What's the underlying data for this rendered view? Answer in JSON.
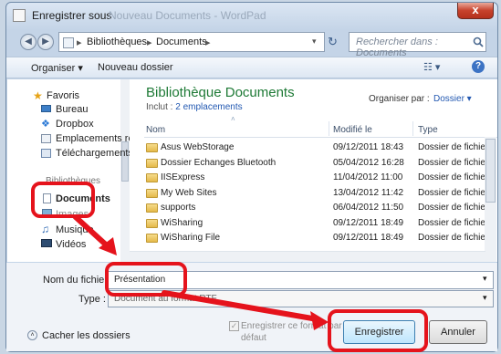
{
  "window": {
    "title": "Enregistrer sous",
    "title_ghost": "Nouveau Documents - WordPad",
    "close_label": "x"
  },
  "address_bar": {
    "crumbs": [
      "Bibliothèques",
      "Documents"
    ],
    "separator": "▸",
    "refresh_glyph": "↻",
    "search_placeholder": "Rechercher dans : Documents"
  },
  "toolbar": {
    "organize_label": "Organiser ▾",
    "new_folder_label": "Nouveau dossier",
    "view_glyph": "☷ ▾",
    "help_glyph": "?"
  },
  "sidebar": {
    "favorites_header": "Favoris",
    "favorites": [
      {
        "label": "Bureau",
        "icon": "desktop-icon"
      },
      {
        "label": "Dropbox",
        "icon": "dropbox-icon"
      },
      {
        "label": "Emplacements ré",
        "icon": "recent-places-icon"
      },
      {
        "label": "Téléchargements",
        "icon": "downloads-icon"
      }
    ],
    "libraries_header": "Bibliothèques",
    "libraries": [
      {
        "label": "Documents",
        "icon": "documents-icon"
      },
      {
        "label": "Images",
        "icon": "pictures-icon"
      },
      {
        "label": "Musique",
        "icon": "music-icon"
      },
      {
        "label": "Vidéos",
        "icon": "videos-icon"
      }
    ]
  },
  "library": {
    "title": "Bibliothèque Documents",
    "includes_prefix": "Inclut :",
    "includes_link": "2 emplacements",
    "arrange_label": "Organiser par :",
    "arrange_value": "Dossier ▾"
  },
  "columns": {
    "name": "Nom",
    "modified": "Modifié le",
    "type": "Type"
  },
  "files": [
    {
      "name": "Asus WebStorage",
      "modified": "09/12/2011 18:43",
      "type": "Dossier de fichiers"
    },
    {
      "name": "Dossier Echanges Bluetooth",
      "modified": "05/04/2012 16:28",
      "type": "Dossier de fichiers"
    },
    {
      "name": "IISExpress",
      "modified": "11/04/2012 11:00",
      "type": "Dossier de fichiers"
    },
    {
      "name": "My Web Sites",
      "modified": "13/04/2012 11:42",
      "type": "Dossier de fichiers"
    },
    {
      "name": "supports",
      "modified": "06/04/2012 11:50",
      "type": "Dossier de fichiers"
    },
    {
      "name": "WiSharing",
      "modified": "09/12/2011 18:49",
      "type": "Dossier de fichiers"
    },
    {
      "name": "WiSharing File",
      "modified": "09/12/2011 18:49",
      "type": "Dossier de fichiers"
    }
  ],
  "form": {
    "filename_label": "Nom du fichier :",
    "filename_value": "Présentation",
    "type_label": "Type :",
    "type_value": "Document au format RTF",
    "hide_folders_label": "Cacher les dossiers",
    "checkbox_label_line1": "Enregistrer ce format par",
    "checkbox_label_line2": "défaut",
    "save_label": "Enregistrer",
    "cancel_label": "Annuler"
  },
  "colors": {
    "annotation": "#e5131c",
    "library_title": "#1e7a36",
    "link": "#2258b1"
  }
}
